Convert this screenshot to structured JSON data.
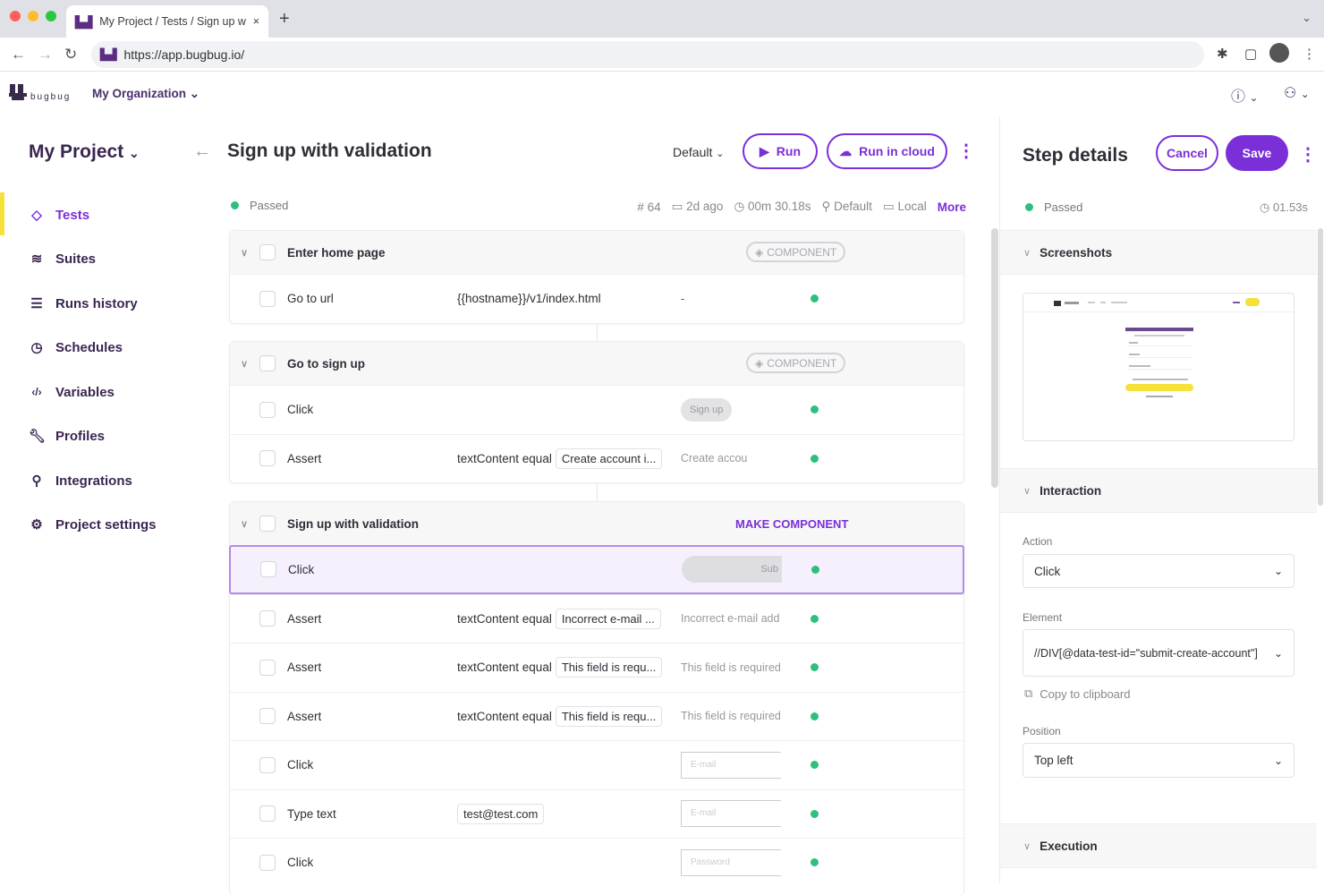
{
  "browser": {
    "tab_title": "My Project / Tests / Sign up wi",
    "url": "https://app.bugbug.io/",
    "new_tab": "+",
    "close": "×"
  },
  "header": {
    "logo_text": "bugbug",
    "organization": "My Organization"
  },
  "sidebar": {
    "project": "My Project",
    "items": [
      {
        "label": "Tests",
        "icon": "diamond-icon",
        "active": true
      },
      {
        "label": "Suites",
        "icon": "layers-icon"
      },
      {
        "label": "Runs history",
        "icon": "list-check-icon"
      },
      {
        "label": "Schedules",
        "icon": "history-icon"
      },
      {
        "label": "Variables",
        "icon": "code-icon"
      },
      {
        "label": "Profiles",
        "icon": "wrench-icon"
      },
      {
        "label": "Integrations",
        "icon": "integration-icon"
      },
      {
        "label": "Project settings",
        "icon": "gear-icon"
      }
    ]
  },
  "test": {
    "title": "Sign up with validation",
    "profile": "Default",
    "run_label": "Run",
    "run_cloud_label": "Run in cloud",
    "status": "Passed",
    "meta": {
      "run_number": "# 64",
      "date": "2d ago",
      "duration": "00m 30.18s",
      "profile": "Default",
      "environment": "Local",
      "more": "More"
    }
  },
  "groups": [
    {
      "name": "Enter home page",
      "badge": "COMPONENT",
      "steps": [
        {
          "action": "Go to url",
          "param": "{{hostname}}/v1/index.html",
          "preview": "-",
          "status": "passed"
        }
      ]
    },
    {
      "name": "Go to sign up",
      "badge": "COMPONENT",
      "steps": [
        {
          "action": "Click",
          "preview": "Sign up",
          "status": "passed"
        },
        {
          "action": "Assert",
          "param_label": "textContent equal",
          "param_value": "Create account i...",
          "preview": "Create accou",
          "status": "passed"
        }
      ]
    },
    {
      "name": "Sign up with validation",
      "badge": "MAKE COMPONENT",
      "steps": [
        {
          "action": "Click",
          "preview": "Sub",
          "status": "passed",
          "selected": true
        },
        {
          "action": "Assert",
          "param_label": "textContent equal",
          "param_value": "Incorrect e-mail ...",
          "preview": "Incorrect e-mail add",
          "status": "passed"
        },
        {
          "action": "Assert",
          "param_label": "textContent equal",
          "param_value": "This field is requ...",
          "preview": "This field is required",
          "status": "passed"
        },
        {
          "action": "Assert",
          "param_label": "textContent equal",
          "param_value": "This field is requ...",
          "preview": "This field is required",
          "status": "passed"
        },
        {
          "action": "Click",
          "preview": "E-mail",
          "status": "passed"
        },
        {
          "action": "Type text",
          "param": "test@test.com",
          "preview": "E-mail",
          "status": "passed"
        },
        {
          "action": "Click",
          "preview": "Password",
          "status": "passed"
        }
      ]
    }
  ],
  "step_details": {
    "title": "Step details",
    "cancel": "Cancel",
    "save": "Save",
    "status": "Passed",
    "duration": "01.53s",
    "sections": {
      "screenshots": "Screenshots",
      "interaction": "Interaction",
      "execution": "Execution"
    },
    "action_label": "Action",
    "action_value": "Click",
    "element_label": "Element",
    "element_value": "//DIV[@data-test-id=\"submit-create-account\"]",
    "copy": "Copy to clipboard",
    "position_label": "Position",
    "position_value": "Top left"
  },
  "colors": {
    "accent": "#7a2fd8",
    "highlight": "#f5e13a",
    "passed": "#2fbf7d"
  }
}
